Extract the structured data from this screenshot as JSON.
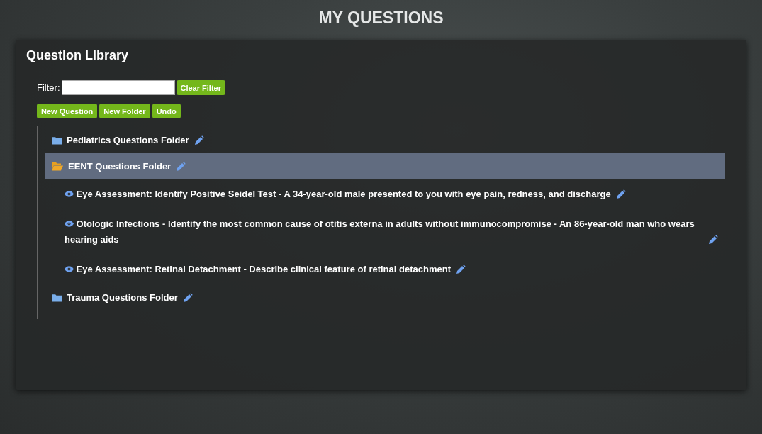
{
  "page_title": "MY QUESTIONS",
  "panel": {
    "title": "Question Library",
    "filter": {
      "label": "Filter:",
      "button": "Clear Filter"
    },
    "actions": [
      "New Question",
      "New Folder",
      "Undo"
    ],
    "tree": [
      {
        "kind": "folder",
        "label": "Pediatrics Questions Folder",
        "expanded": false,
        "selected": false
      },
      {
        "kind": "folder",
        "label": "EENT Questions Folder",
        "expanded": true,
        "selected": true,
        "children": [
          {
            "kind": "question",
            "label": "Eye Assessment: Identify Positive Seidel Test - A 34-year-old male presented to you with eye pain, redness, and discharge",
            "selected": false
          },
          {
            "kind": "question",
            "label": "Otologic Infections - Identify the most common cause of otitis externa in adults without immunocompromise - An 86-year-old man who wears hearing aids",
            "selected": false
          },
          {
            "kind": "question",
            "label": "Eye Assessment: Retinal Detachment - Describe clinical feature of retinal detachment",
            "selected": false
          }
        ]
      },
      {
        "kind": "folder",
        "label": "Trauma Questions Folder",
        "expanded": false,
        "selected": false
      }
    ]
  }
}
